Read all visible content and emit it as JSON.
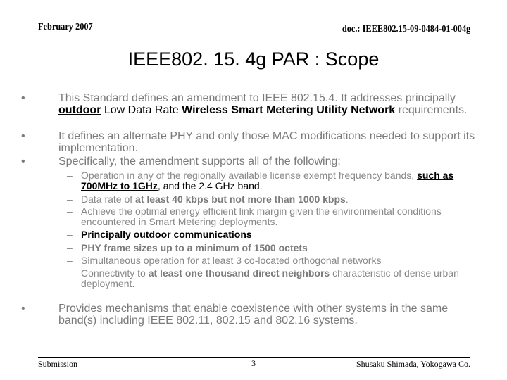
{
  "header": {
    "date": "February 2007",
    "doc_id": "doc.: IEEE802.15-09-0484-01-004g"
  },
  "title": "IEEE802. 15. 4g  PAR : Scope",
  "bullets": {
    "b1": {
      "p1": "This Standard defines an amendment to IEEE 802.15.4. It addresses principally ",
      "p2": "outdoor",
      "p3": " Low Data Rate ",
      "p4": "Wireless Smart Metering Utility Network",
      "p5": " requirements."
    },
    "b2": "It defines an alternate PHY and only those MAC modifications needed to support its implementation.",
    "b3": "Specifically, the amendment supports all of the following:",
    "b4": "Provides mechanisms that enable coexistence with other systems in the same band(s) including IEEE 802.11, 802.15 and 802.16  systems."
  },
  "sub_items": {
    "s1": {
      "p1": " Operation in any of the regionally available license exempt frequency bands, ",
      "p2": "such as 700MHz to 1GHz",
      "p3": ", and the 2.4 GHz band."
    },
    "s2": {
      "p1": "Data rate of ",
      "p2": "at least 40 kbps but not more than 1000 kbps",
      "p3": "."
    },
    "s3": " Achieve the optimal energy efficient link margin given the environmental conditions encountered in Smart Metering deployments.",
    "s4": "Principally outdoor communications",
    "s5": "PHY frame sizes up to a minimum of 1500 octets",
    "s6": " Simultaneous operation for at least 3 co-located orthogonal networks",
    "s7": {
      "p1": " Connectivity to ",
      "p2": "at least one thousand direct neighbors",
      "p3": " characteristic of dense urban deployment."
    }
  },
  "markers": {
    "bullet": "•",
    "dash": "–"
  },
  "footer": {
    "left": "Submission",
    "page": "3",
    "author": "Shusaku Shimada, Yokogawa Co."
  }
}
